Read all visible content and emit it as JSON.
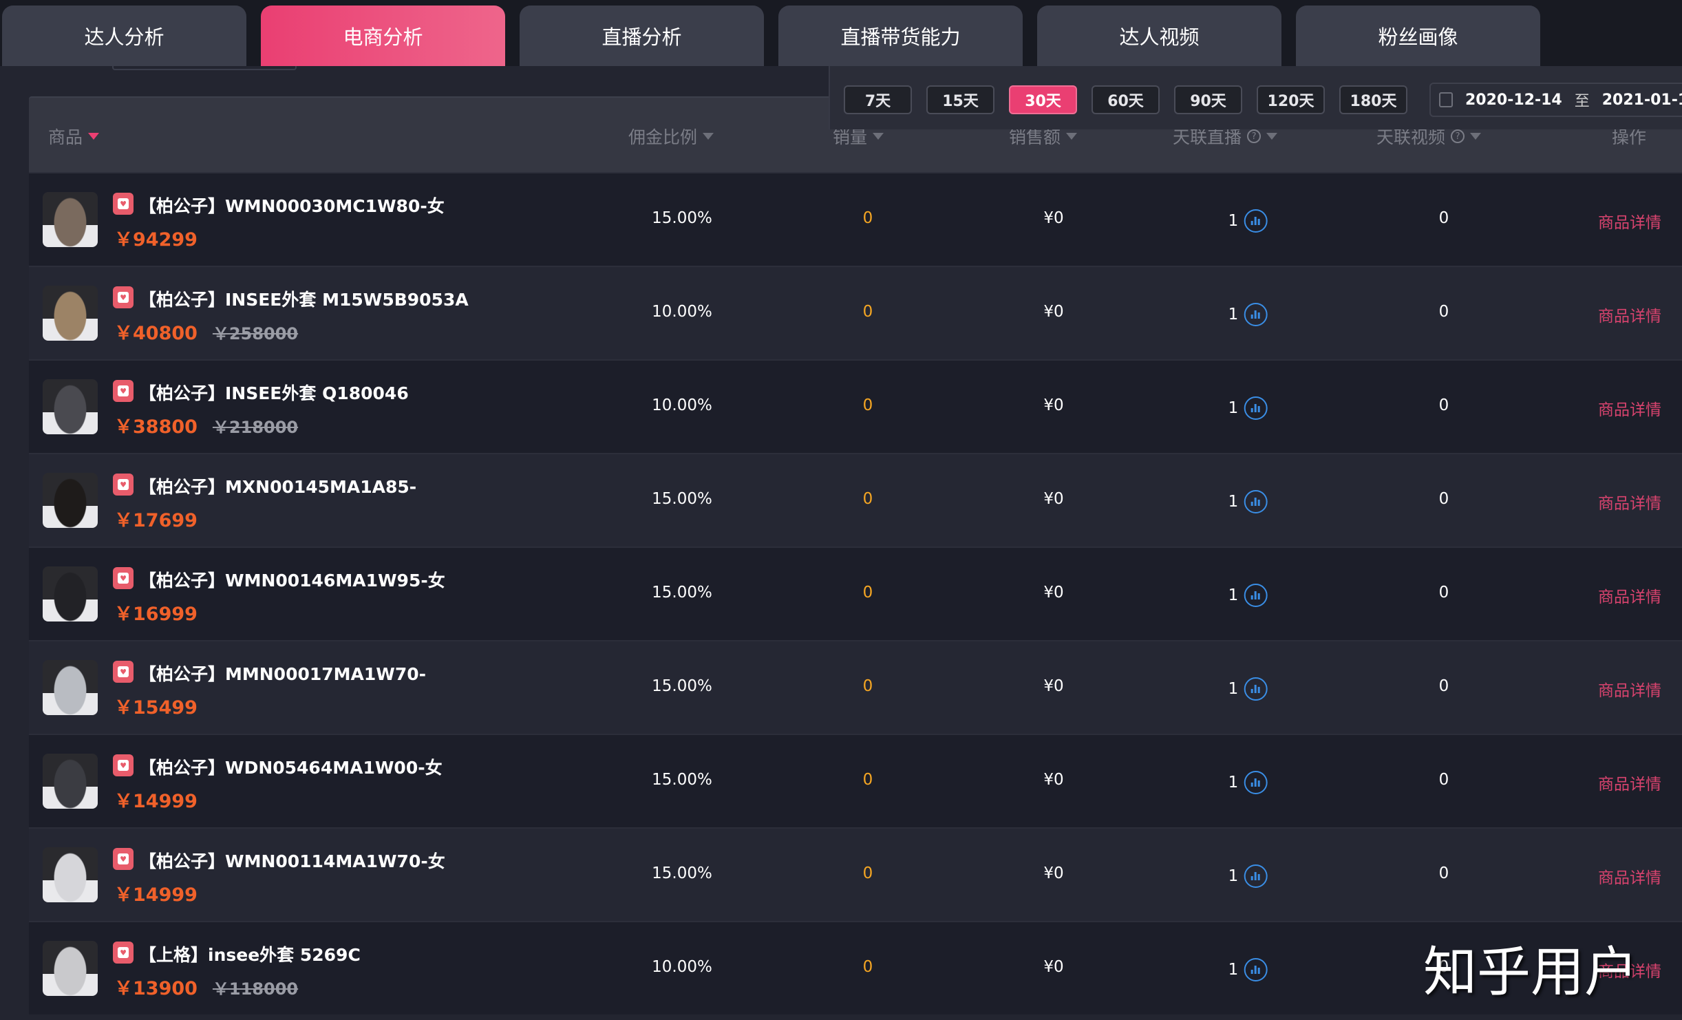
{
  "tabs": [
    {
      "label": "达人分析"
    },
    {
      "label": "电商分析",
      "active": true
    },
    {
      "label": "直播分析"
    },
    {
      "label": "直播带货能力"
    },
    {
      "label": "达人视频"
    },
    {
      "label": "粉丝画像"
    }
  ],
  "filter": {
    "ranges": [
      "7天",
      "15天",
      "30天",
      "60天",
      "90天",
      "120天",
      "180天"
    ],
    "active_range": "30天",
    "date_start": "2020-12-14",
    "date_sep": "至",
    "date_end": "2021-01-1"
  },
  "table": {
    "headers": {
      "product": "商品",
      "commission": "佣金比例",
      "sales": "销量",
      "revenue": "销售额",
      "live": "天联直播",
      "video": "天联视频",
      "action": "操作",
      "help": "?"
    },
    "rows": [
      {
        "title": "【柏公子】WMN00030MC1W80-女",
        "price": "￥94299",
        "orig": "",
        "commission": "15.00%",
        "sales": "0",
        "revenue": "¥0",
        "live": "1",
        "video": "0",
        "action": "商品详情",
        "thumb": "#7a6a5e"
      },
      {
        "title": "【柏公子】INSEE外套 M15W5B9053A",
        "price": "￥40800",
        "orig": "￥258000",
        "commission": "10.00%",
        "sales": "0",
        "revenue": "¥0",
        "live": "1",
        "video": "0",
        "action": "商品详情",
        "thumb": "#9c8366"
      },
      {
        "title": "【柏公子】INSEE外套 Q180046",
        "price": "￥38800",
        "orig": "￥218000",
        "commission": "10.00%",
        "sales": "0",
        "revenue": "¥0",
        "live": "1",
        "video": "0",
        "action": "商品详情",
        "thumb": "#4a4a50"
      },
      {
        "title": "【柏公子】MXN00145MA1A85-",
        "price": "￥17699",
        "orig": "",
        "commission": "15.00%",
        "sales": "0",
        "revenue": "¥0",
        "live": "1",
        "video": "0",
        "action": "商品详情",
        "thumb": "#1e1b1a"
      },
      {
        "title": "【柏公子】WMN00146MA1W95-女",
        "price": "￥16999",
        "orig": "",
        "commission": "15.00%",
        "sales": "0",
        "revenue": "¥0",
        "live": "1",
        "video": "0",
        "action": "商品详情",
        "thumb": "#222226"
      },
      {
        "title": "【柏公子】MMN00017MA1W70-",
        "price": "￥15499",
        "orig": "",
        "commission": "15.00%",
        "sales": "0",
        "revenue": "¥0",
        "live": "1",
        "video": "0",
        "action": "商品详情",
        "thumb": "#b9bcc2"
      },
      {
        "title": "【柏公子】WDN05464MA1W00-女",
        "price": "￥14999",
        "orig": "",
        "commission": "15.00%",
        "sales": "0",
        "revenue": "¥0",
        "live": "1",
        "video": "0",
        "action": "商品详情",
        "thumb": "#3b3c42"
      },
      {
        "title": "【柏公子】WMN00114MA1W70-女",
        "price": "￥14999",
        "orig": "",
        "commission": "15.00%",
        "sales": "0",
        "revenue": "¥0",
        "live": "1",
        "video": "0",
        "action": "商品详情",
        "thumb": "#d6d6da"
      },
      {
        "title": "【上格】insee外套 5269C",
        "price": "￥13900",
        "orig": "￥118000",
        "commission": "10.00%",
        "sales": "0",
        "revenue": "¥0",
        "live": "1",
        "video": "0",
        "action": "商品详情",
        "thumb": "#c9c9cc"
      }
    ]
  },
  "watermark": "知乎用户",
  "colors": {
    "accent": "#ea3f72",
    "price": "#f0612a",
    "sales": "#f5a623",
    "link": "#d8436e",
    "live_icon": "#3a8ee6"
  }
}
